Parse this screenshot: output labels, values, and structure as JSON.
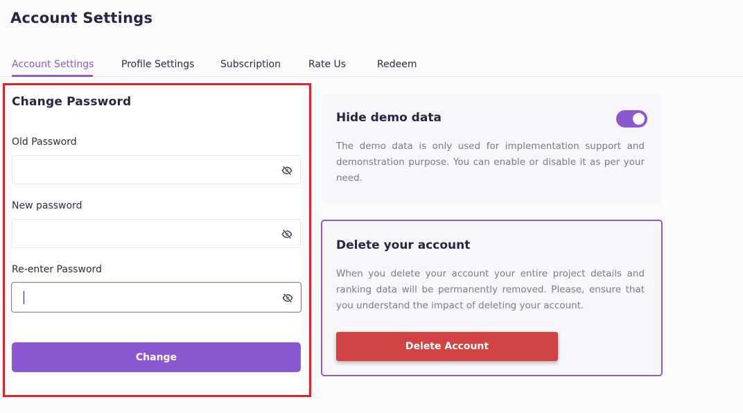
{
  "header": {
    "title": "Account Settings"
  },
  "tabs": [
    {
      "label": "Account Settings",
      "active": true
    },
    {
      "label": "Profile Settings",
      "active": false
    },
    {
      "label": "Subscription",
      "active": false
    },
    {
      "label": "Rate Us",
      "active": false
    },
    {
      "label": "Redeem",
      "active": false
    }
  ],
  "change_password": {
    "title": "Change Password",
    "old_password": {
      "label": "Old Password",
      "value": "",
      "icon": "eye-slash-icon"
    },
    "new_password": {
      "label": "New password",
      "value": "",
      "icon": "eye-slash-icon"
    },
    "reenter_password": {
      "label": "Re-enter Password",
      "value": "",
      "icon": "eye-slash-icon",
      "focused": true
    },
    "button_label": "Change"
  },
  "demo_data": {
    "title": "Hide demo data",
    "description": "The demo data is only used for implementation support and demonstration purpose. You can enable or disable it as per your need.",
    "toggle_on": true
  },
  "delete_account": {
    "title": "Delete your account",
    "description": "When you delete your account your entire project details and ranking data will be permanently removed. Please, ensure that you understand the impact of deleting your account.",
    "button_label": "Delete Account"
  },
  "colors": {
    "accent": "#8a59d2",
    "danger": "#d14242",
    "highlight": "#e2222a"
  }
}
